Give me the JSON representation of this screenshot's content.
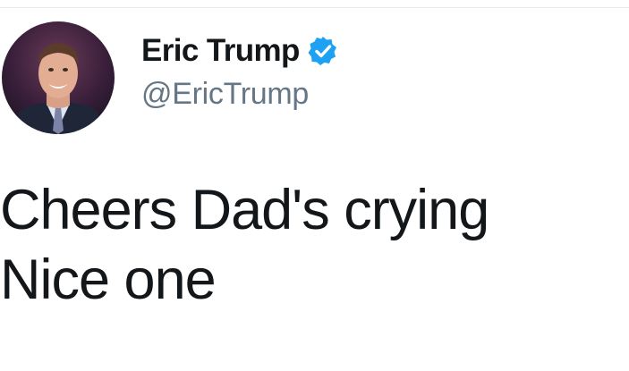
{
  "tweet": {
    "display_name": "Eric Trump",
    "handle": "@EricTrump",
    "verified": true,
    "text_lines": [
      "Cheers Dad's crying",
      "Nice one"
    ]
  },
  "colors": {
    "verified_badge": "#1da1f2",
    "handle_gray": "#657786",
    "text_dark": "#14171a"
  },
  "icons": {
    "avatar": "profile-photo",
    "verified": "verified-badge-icon"
  }
}
